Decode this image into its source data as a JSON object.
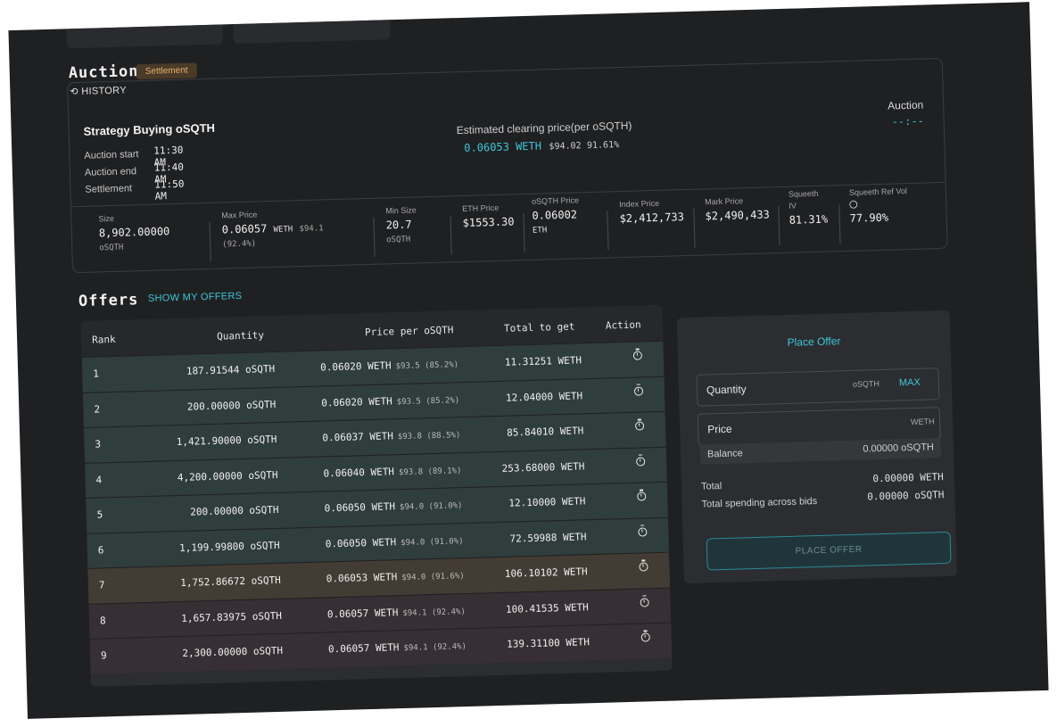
{
  "auction": {
    "title": "Auction",
    "badge": "Settlement",
    "history_label": "HISTORY",
    "strategy_title": "Strategy Buying oSQTH",
    "start_label": "Auction start",
    "start_value": "11:30 AM",
    "end_label": "Auction end",
    "end_value": "11:40 AM",
    "settlement_label": "Settlement",
    "settlement_value": "11:50 AM",
    "clearing_label": "Estimated clearing price(per oSQTH)",
    "clearing_weth": "0.06053 WETH",
    "clearing_usd": "$94.02",
    "clearing_pct": "91.61%",
    "timer_label": "Auction",
    "timer_value": "--:--",
    "stats": {
      "size_h": "Size",
      "size_v": "8,902.00000",
      "size_u": "oSQTH",
      "maxprice_h": "Max Price",
      "maxprice_v": "0.06057",
      "maxprice_u": "WETH",
      "maxprice_usd": "$94.1",
      "maxprice_pct": "(92.4%)",
      "minsize_h": "Min Size",
      "minsize_v": "20.7",
      "minsize_u": "oSQTH",
      "ethprice_h": "ETH Price",
      "ethprice_v": "$1553.30",
      "osqthprice_h": "oSQTH Price",
      "osqthprice_v": "0.06002",
      "osqthprice_u": "ETH",
      "indexprice_h": "Index Price",
      "indexprice_v": "$2,412,733",
      "markprice_h": "Mark Price",
      "markprice_v": "$2,490,433",
      "iv_h1": "Squeeth",
      "iv_h2": "IV",
      "iv_v": "81.31%",
      "refvol_h": "Squeeth Ref Vol",
      "refvol_v": "77.90%"
    }
  },
  "offers": {
    "title": "Offers",
    "show_mine": "SHOW MY OFFERS",
    "headers": {
      "rank": "Rank",
      "quantity": "Quantity",
      "price": "Price per oSQTH",
      "total": "Total to get",
      "action": "Action"
    },
    "rows": [
      {
        "rank": "1",
        "qty": "187.91544 oSQTH",
        "price": "0.06020 WETH",
        "usd": "$93.5 (85.2%)",
        "total": "11.31251 WETH"
      },
      {
        "rank": "2",
        "qty": "200.00000 oSQTH",
        "price": "0.06020 WETH",
        "usd": "$93.5 (85.2%)",
        "total": "12.04000 WETH"
      },
      {
        "rank": "3",
        "qty": "1,421.90000 oSQTH",
        "price": "0.06037 WETH",
        "usd": "$93.8 (88.5%)",
        "total": "85.84010 WETH"
      },
      {
        "rank": "4",
        "qty": "4,200.00000 oSQTH",
        "price": "0.06040 WETH",
        "usd": "$93.8 (89.1%)",
        "total": "253.68000 WETH"
      },
      {
        "rank": "5",
        "qty": "200.00000 oSQTH",
        "price": "0.06050 WETH",
        "usd": "$94.0 (91.0%)",
        "total": "12.10000 WETH"
      },
      {
        "rank": "6",
        "qty": "1,199.99800 oSQTH",
        "price": "0.06050 WETH",
        "usd": "$94.0 (91.0%)",
        "total": "72.59988 WETH"
      },
      {
        "rank": "7",
        "qty": "1,752.86672 oSQTH",
        "price": "0.06053 WETH",
        "usd": "$94.0 (91.6%)",
        "total": "106.10102 WETH"
      },
      {
        "rank": "8",
        "qty": "1,657.83975 oSQTH",
        "price": "0.06057 WETH",
        "usd": "$94.1 (92.4%)",
        "total": "100.41535 WETH"
      },
      {
        "rank": "9",
        "qty": "2,300.00000 oSQTH",
        "price": "0.06057 WETH",
        "usd": "$94.1 (92.4%)",
        "total": "139.31100 WETH"
      }
    ]
  },
  "place_offer": {
    "title": "Place Offer",
    "quantity_label": "Quantity",
    "quantity_unit": "oSQTH",
    "max_label": "MAX",
    "price_label": "Price",
    "price_unit": "WETH",
    "balance_label": "Balance",
    "balance_value": "0.00000 oSQTH",
    "total_label": "Total",
    "total_value": "0.00000 WETH",
    "spending_label": "Total spending across bids",
    "spending_value": "0.00000 oSQTH",
    "button_label": "PLACE OFFER"
  },
  "colors": {
    "accent": "#3fc8d8",
    "row_green": "#2f3d3c",
    "row_orange": "#433c34",
    "row_red": "#372f34",
    "badge_bg": "#4a3a28"
  }
}
